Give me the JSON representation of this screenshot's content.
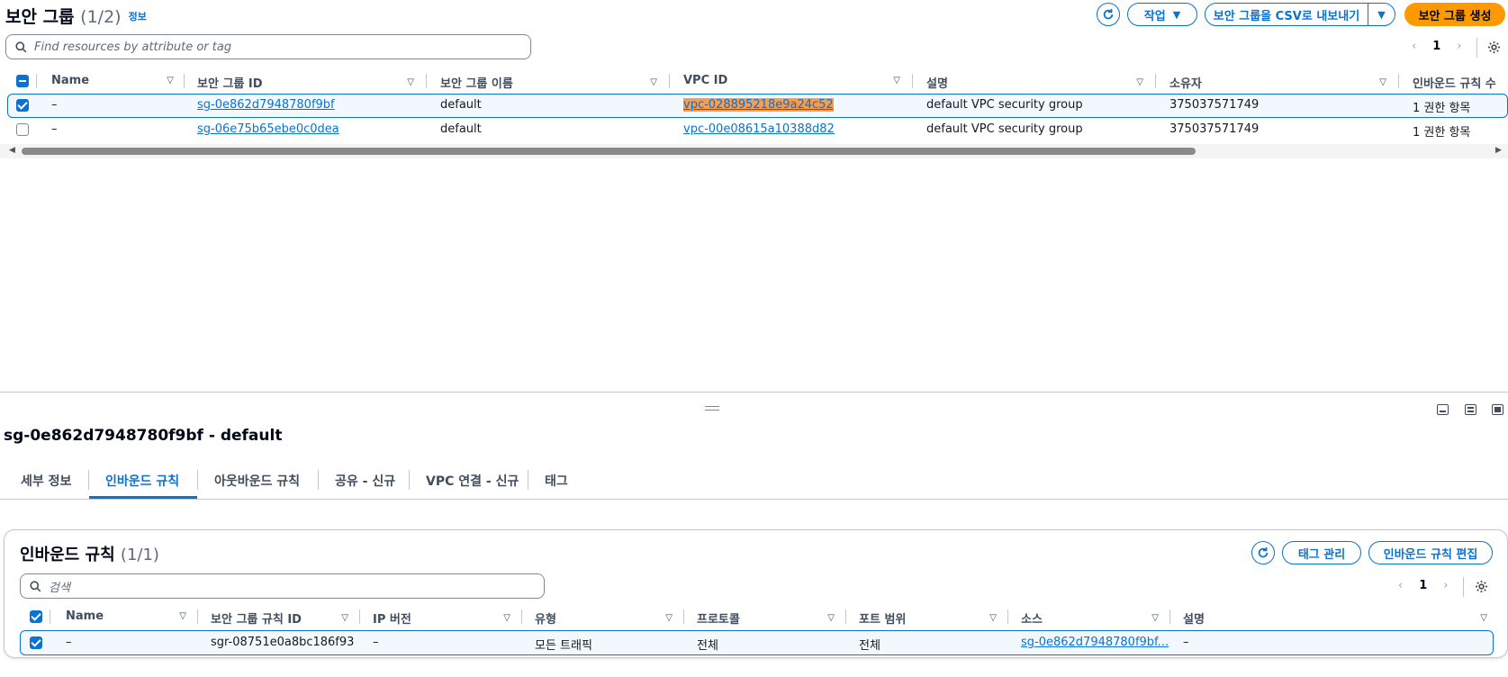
{
  "sg_panel": {
    "title": "보안 그룹",
    "count": "(1/2)",
    "info": "정보",
    "actions_label": "작업",
    "export_label": "보안 그룹을 CSV로 내보내기",
    "create_label": "보안 그룹 생성",
    "search_placeholder": "Find resources by attribute or tag",
    "page": "1",
    "columns": [
      "Name",
      "보안 그룹 ID",
      "보안 그룹 이름",
      "VPC ID",
      "설명",
      "소유자",
      "인바운드 규칙 수"
    ],
    "rows": [
      {
        "name": "–",
        "sg_id": "sg-0e862d7948780f9bf",
        "sg_name": "default",
        "vpc_id": "vpc-028895218e9a24c52",
        "desc": "default VPC security group",
        "owner": "375037571749",
        "inbound": "1 권한 항목"
      },
      {
        "name": "–",
        "sg_id": "sg-06e75b65ebe0c0dea",
        "sg_name": "default",
        "vpc_id": "vpc-00e08615a10388d82",
        "desc": "default VPC security group",
        "owner": "375037571749",
        "inbound": "1 권한 항목"
      }
    ]
  },
  "detail": {
    "title": "sg-0e862d7948780f9bf - default",
    "tabs": [
      "세부 정보",
      "인바운드 규칙",
      "아웃바운드 규칙",
      "공유 - 신규",
      "VPC 연결 - 신규",
      "태그"
    ],
    "active_tab": "인바운드 규칙"
  },
  "inbound": {
    "title": "인바운드 규칙",
    "count": "(1/1)",
    "manage_tags_label": "태그 관리",
    "edit_rules_label": "인바운드 규칙 편집",
    "search_placeholder": "검색",
    "page": "1",
    "columns": [
      "Name",
      "보안 그룹 규칙 ID",
      "IP 버전",
      "유형",
      "프로토콜",
      "포트 범위",
      "소스",
      "설명"
    ],
    "rows": [
      {
        "name": "–",
        "rule_id": "sgr-08751e0a8bc186f93",
        "ip_version": "–",
        "type": "모든 트래픽",
        "protocol": "전체",
        "port_range": "전체",
        "source": "sg-0e862d7948780f9bf...",
        "desc": "–"
      }
    ]
  },
  "colors": {
    "accent": "#0972d3",
    "primary": "#ff9900",
    "highlight": "#f89c4e"
  }
}
